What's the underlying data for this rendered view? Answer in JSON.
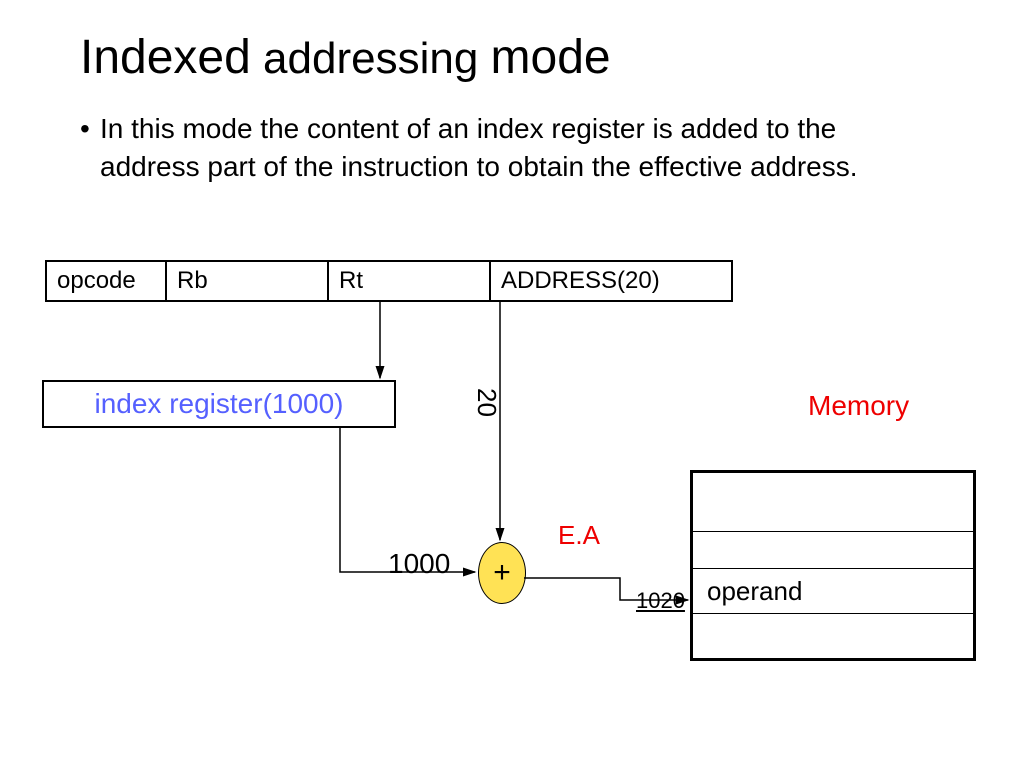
{
  "title": {
    "word1": "Indexed",
    "word2": "addressing",
    "word3": "mode"
  },
  "bullet": "In this mode the content of an index register is added to the address part of the instruction to obtain the effective address.",
  "instruction": {
    "opcode": "opcode",
    "rb": "Rb",
    "rt": "Rt",
    "address": "ADDRESS(20)"
  },
  "index_register": "index  register(1000)",
  "labels": {
    "twenty": "20",
    "memory": "Memory",
    "ea": "E.A",
    "thousand": "1000",
    "result": "1020"
  },
  "adder_symbol": "+",
  "memory_rows": {
    "operand": "operand"
  }
}
